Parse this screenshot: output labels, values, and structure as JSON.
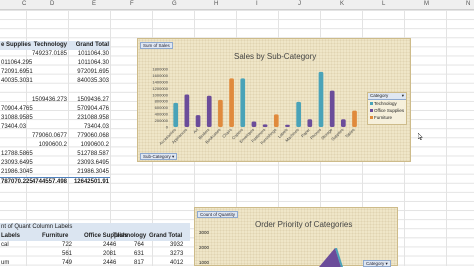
{
  "columns": [
    "C",
    "D",
    "E",
    "F",
    "G",
    "H",
    "I",
    "J",
    "K",
    "L",
    "M",
    "N"
  ],
  "pivot1": {
    "headers": [
      "e Supplies",
      "Technology",
      "Grand Total"
    ],
    "rows": [
      [
        "",
        "749237.0185",
        "1011064.30"
      ],
      [
        "011064.295",
        "",
        "1011064.30"
      ],
      [
        "72091.6951",
        "",
        "972091.695"
      ],
      [
        "40035.3031",
        "",
        "840035.303"
      ],
      [
        "",
        "",
        ""
      ],
      [
        "",
        "1509436.273",
        "1509436.27"
      ],
      [
        "70904.4765",
        "",
        "570904.476"
      ],
      [
        "31088.9585",
        "",
        "231088.958"
      ],
      [
        "73404.03",
        "",
        "73404.03"
      ],
      [
        "",
        "779060.0677",
        "779060.068"
      ],
      [
        "",
        "1090600.2",
        "1090600.2"
      ],
      [
        "12788.5865",
        "",
        "512788.587"
      ],
      [
        "23093.6495",
        "",
        "23093.6495"
      ],
      [
        "21986.3045",
        "",
        "21986.3045"
      ]
    ],
    "total": [
      "787070.225",
      "4744557.498",
      "12642501.91"
    ]
  },
  "pivot2": {
    "header": "nt of Quant Column Labels",
    "subheader": [
      "Labels",
      "Furniture",
      "Office Supplies",
      "Technology",
      "Grand Total"
    ],
    "rows": [
      [
        "cal",
        "722",
        "2446",
        "764",
        "3932"
      ],
      [
        "",
        "561",
        "2081",
        "631",
        "3273"
      ],
      [
        "um",
        "749",
        "2446",
        "817",
        "4012"
      ]
    ]
  },
  "chart1": {
    "field_button": "Sum of Sales",
    "title": "Sales by Sub-Category",
    "axis_button": "Sub-Category",
    "legend_header": "Category",
    "legend": [
      "Technology",
      "Office Supplies",
      "Furniture"
    ],
    "colors": {
      "Technology": "#4aa3b8",
      "Office Supplies": "#6b4c9a",
      "Furniture": "#e08a3c"
    }
  },
  "chart2": {
    "field_button": "Count of Quantity",
    "title": "Order Priority of Categories",
    "y_ticks": [
      "3000",
      "2000",
      "1000"
    ],
    "legend_header": "Category"
  },
  "chart_data": {
    "type": "bar",
    "title": "Sales by Sub-Category",
    "categories": [
      "Accessories",
      "Appliances",
      "Art",
      "Binders",
      "Bookcases",
      "Chairs",
      "Copiers",
      "Envelopes",
      "Fasteners",
      "Furnishings",
      "Labels",
      "Machines",
      "Paper",
      "Phones",
      "Storage",
      "Supplies",
      "Tables"
    ],
    "category_colors": [
      "#4aa3b8",
      "#6b4c9a",
      "#6b4c9a",
      "#6b4c9a",
      "#e08a3c",
      "#e08a3c",
      "#4aa3b8",
      "#6b4c9a",
      "#6b4c9a",
      "#e08a3c",
      "#6b4c9a",
      "#4aa3b8",
      "#6b4c9a",
      "#4aa3b8",
      "#6b4c9a",
      "#6b4c9a",
      "#e08a3c"
    ],
    "values": [
      750000,
      1010000,
      370000,
      970000,
      840000,
      1510000,
      1510000,
      170000,
      80000,
      390000,
      70000,
      780000,
      240000,
      1710000,
      1130000,
      240000,
      510000
    ],
    "y_ticks": [
      "1800000",
      "1600000",
      "1400000",
      "1200000",
      "1000000",
      "800000",
      "600000",
      "400000",
      "200000",
      "0"
    ],
    "ylim": [
      0,
      1800000
    ]
  }
}
